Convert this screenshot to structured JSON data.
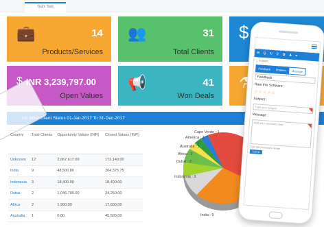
{
  "tab": {
    "label": "Team Task"
  },
  "cards": [
    {
      "value": "14",
      "label": "Products/Services",
      "icon": "briefcase-icon"
    },
    {
      "value": "31",
      "label": "Total Clients",
      "icon": "users-icon"
    },
    {
      "value": "$",
      "label": "",
      "icon": "dollar-icon"
    },
    {
      "value": "INR 3,239,797.00",
      "label": "Open Values",
      "icon": "dollar-icon"
    },
    {
      "value": "41",
      "label": "Won Deals",
      "icon": "megaphone-icon"
    },
    {
      "value": "",
      "label": "",
      "icon": "flask-icon"
    }
  ],
  "banner": {
    "title": "ion Wise Client Status 01-Jan-2017 To 31-Dec-2017"
  },
  "table": {
    "headers": [
      "Country",
      "Total Clients",
      "Opportunity Values (INR)",
      "Closed Values (INR)"
    ],
    "rows": [
      [
        "Unknown",
        "12",
        "2,067,617.00",
        "172,140.00"
      ],
      [
        "India",
        "9",
        "48,500.00",
        "204,375.75"
      ],
      [
        "Indonesia",
        "3",
        "18,400.00",
        "18,400.00"
      ],
      [
        "Dubai",
        "2",
        "1,046,700.00",
        "24,250.00"
      ],
      [
        "Africa",
        "2",
        "1,900.00",
        "17,600.00"
      ],
      [
        "Australia",
        "1",
        "0.00",
        "45,500.00"
      ]
    ]
  },
  "chart_data": {
    "type": "pie",
    "categories": [
      "India",
      "Indonesia",
      "Dubai",
      "Africa",
      "Australia",
      "America",
      "Cape Verde",
      "Unknown"
    ],
    "values": [
      9,
      3,
      2,
      2,
      1,
      1,
      1,
      12
    ],
    "labels": [
      "India : 9",
      "Indonesia : 3",
      "Dubai : 2",
      "Africa : 2",
      "Australia : 1",
      "America : 1",
      "Cape Verde : 1"
    ],
    "colors": [
      "#f28a1e",
      "#d9d9d9",
      "#9fd42b",
      "#6cc04a",
      "#f6e04b",
      "#2e9e3c",
      "#2d7bd6",
      "#e24b3d"
    ]
  },
  "phone": {
    "nav": "✉ Q ↻ ⚲ ✿ ♟ ▸",
    "crumb": "⌂ Support",
    "tabs": [
      "Feedback",
      "Problem",
      "Message"
    ],
    "feedback": "Feedback",
    "rate_label": "Rate this Software :",
    "stars": "☆☆☆☆☆",
    "subject_label": "Subject :",
    "subject_placeholder": "Type your subject",
    "message_label": "Message :",
    "message_placeholder": "Add your comment here...",
    "note": "Total 500 Characters remain.",
    "submit": "Submit"
  }
}
